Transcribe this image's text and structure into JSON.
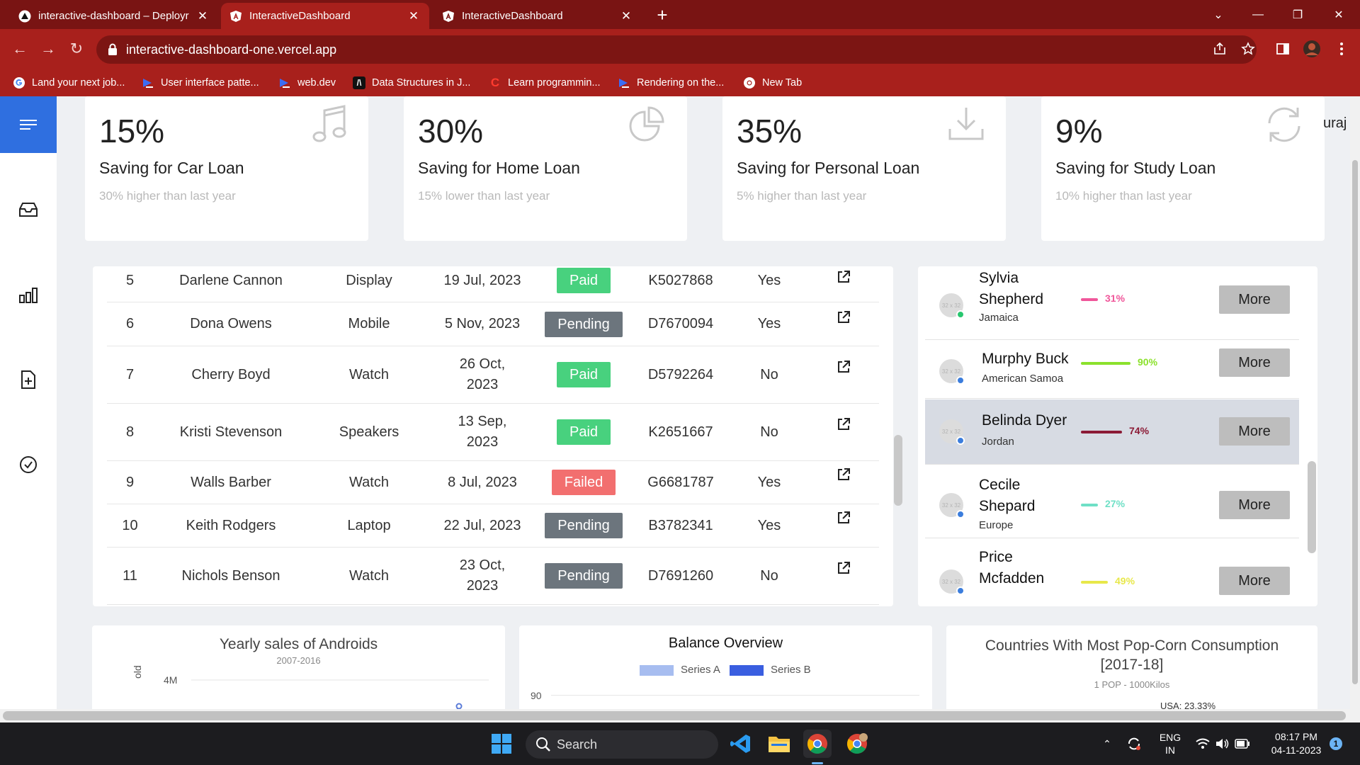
{
  "browser": {
    "tabs": [
      {
        "title": "interactive-dashboard – Deployr",
        "active": false
      },
      {
        "title": "InteractiveDashboard",
        "active": true
      },
      {
        "title": "InteractiveDashboard",
        "active": false
      }
    ],
    "url": "interactive-dashboard-one.vercel.app",
    "bookmarks": [
      {
        "label": "Land your next job...",
        "icon": "google-icon"
      },
      {
        "label": "User interface patte...",
        "icon": "web-dev-icon"
      },
      {
        "label": "web.dev",
        "icon": "web-dev-icon"
      },
      {
        "label": "Data Structures in J...",
        "icon": "angular-icon"
      },
      {
        "label": "Learn programmin...",
        "icon": "codecademy-icon"
      },
      {
        "label": "Rendering on the...",
        "icon": "web-dev-icon"
      },
      {
        "label": "New Tab",
        "icon": "chrome-icon"
      }
    ]
  },
  "header": {
    "user_fragment": "uraj"
  },
  "cards": [
    {
      "percent": "15%",
      "title": "Saving for Car Loan",
      "subtitle": "30% higher than last year",
      "icon": "music-icon"
    },
    {
      "percent": "30%",
      "title": "Saving for Home Loan",
      "subtitle": "15% lower than last year",
      "icon": "pie-chart-icon"
    },
    {
      "percent": "35%",
      "title": "Saving for Personal Loan",
      "subtitle": "5% higher than last year",
      "icon": "download-icon"
    },
    {
      "percent": "9%",
      "title": "Saving for Study Loan",
      "subtitle": "10% higher than last year",
      "icon": "refresh-icon"
    }
  ],
  "orders": [
    {
      "id": "5",
      "name": "Darlene Cannon",
      "product": "Display",
      "date": "19 Jul, 2023",
      "status": "Paid",
      "tracking": "K5027868",
      "delivered": "Yes"
    },
    {
      "id": "6",
      "name": "Dona Owens",
      "product": "Mobile",
      "date": "5 Nov, 2023",
      "status": "Pending",
      "tracking": "D7670094",
      "delivered": "Yes"
    },
    {
      "id": "7",
      "name": "Cherry Boyd",
      "product": "Watch",
      "date": "26 Oct, 2023",
      "status": "Paid",
      "tracking": "D5792264",
      "delivered": "No"
    },
    {
      "id": "8",
      "name": "Kristi Stevenson",
      "product": "Speakers",
      "date": "13 Sep, 2023",
      "status": "Paid",
      "tracking": "K2651667",
      "delivered": "No"
    },
    {
      "id": "9",
      "name": "Walls Barber",
      "product": "Watch",
      "date": "8 Jul, 2023",
      "status": "Failed",
      "tracking": "G6681787",
      "delivered": "Yes"
    },
    {
      "id": "10",
      "name": "Keith Rodgers",
      "product": "Laptop",
      "date": "22 Jul, 2023",
      "status": "Pending",
      "tracking": "B3782341",
      "delivered": "Yes"
    },
    {
      "id": "11",
      "name": "Nichols Benson",
      "product": "Watch",
      "date": "23 Oct, 2023",
      "status": "Pending",
      "tracking": "D7691260",
      "delivered": "No"
    }
  ],
  "status_colors": {
    "Paid": "#48d17e",
    "Pending": "#6c757d",
    "Failed": "#f26f6f"
  },
  "people": [
    {
      "name": "Sylvia Shepherd",
      "location": "Jamaica",
      "percent": "31%",
      "progress": 0.31,
      "color": "#f0569a",
      "dot": "#28c76f",
      "avatar": "32 x 32",
      "more": "More"
    },
    {
      "name": "Murphy Buck",
      "location": "American Samoa",
      "percent": "90%",
      "progress": 0.9,
      "color": "#8be12c",
      "dot": "#3b7ddd",
      "avatar": "32 x 32",
      "more": "More"
    },
    {
      "name": "Belinda Dyer",
      "location": "Jordan",
      "percent": "74%",
      "progress": 0.74,
      "color": "#8b1a35",
      "dot": "#3b7ddd",
      "avatar": "32 x 32",
      "more": "More"
    },
    {
      "name": "Cecile Shepard",
      "location": "Europe",
      "percent": "27%",
      "progress": 0.27,
      "color": "#6fe0c6",
      "dot": "#3b7ddd",
      "avatar": "32 x 32",
      "more": "More"
    },
    {
      "name": "Price Mcfadden",
      "location": "",
      "percent": "49%",
      "progress": 0.49,
      "color": "#e8e84a",
      "dot": "#3b7ddd",
      "avatar": "32 x 32",
      "more": "More"
    }
  ],
  "charts": [
    {
      "title": "Yearly sales of Androids",
      "subtitle": "2007-2016",
      "axis_label": "old",
      "first_tick": "4M"
    },
    {
      "title": "Balance Overview",
      "legend": [
        "Series A",
        "Series B"
      ],
      "first_tick": "90"
    },
    {
      "title": "Countries With Most Pop-Corn Consumption [2017-18]",
      "subtitle": "1 POP - 1000Kilos",
      "label": "USA: 23.33%"
    }
  ],
  "chart_data": [
    {
      "type": "line",
      "title": "Yearly sales of Androids",
      "subtitle": "2007-2016",
      "yticks": [
        "4M"
      ]
    },
    {
      "type": "bar",
      "title": "Balance Overview",
      "series": [
        {
          "name": "Series A",
          "color": "#a7bdf0"
        },
        {
          "name": "Series B",
          "color": "#3a5ee0"
        }
      ],
      "yticks": [
        "90"
      ]
    },
    {
      "type": "pie",
      "title": "Countries With Most Pop-Corn Consumption [2017-18]",
      "subtitle": "1 POP - 1000Kilos",
      "labels": [
        "USA: 23.33%"
      ]
    }
  ],
  "taskbar": {
    "search": "Search",
    "lang_top": "ENG",
    "lang_bottom": "IN",
    "time": "08:17 PM",
    "date": "04-11-2023",
    "notif_count": "1"
  }
}
